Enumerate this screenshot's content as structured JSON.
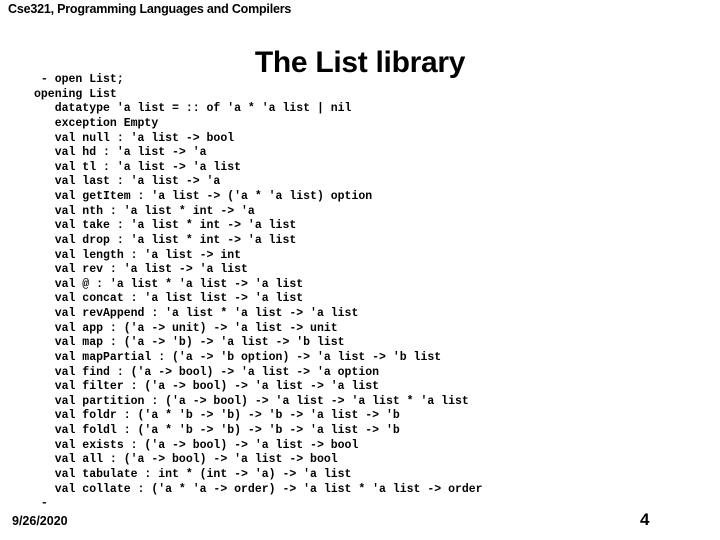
{
  "slide": {
    "course_header": "Cse321, Programming Languages and Compilers",
    "title": "The List library",
    "footer_date": "9/26/2020",
    "page_number": "4",
    "background_color": "#ffffff",
    "text_color": "#000000"
  },
  "code": {
    "lines": [
      " - open List;",
      "opening List",
      "   datatype 'a list = :: of 'a * 'a list | nil",
      "   exception Empty",
      "   val null : 'a list -> bool",
      "   val hd : 'a list -> 'a",
      "   val tl : 'a list -> 'a list",
      "   val last : 'a list -> 'a",
      "   val getItem : 'a list -> ('a * 'a list) option",
      "   val nth : 'a list * int -> 'a",
      "   val take : 'a list * int -> 'a list",
      "   val drop : 'a list * int -> 'a list",
      "   val length : 'a list -> int",
      "   val rev : 'a list -> 'a list",
      "   val @ : 'a list * 'a list -> 'a list",
      "   val concat : 'a list list -> 'a list",
      "   val revAppend : 'a list * 'a list -> 'a list",
      "   val app : ('a -> unit) -> 'a list -> unit",
      "   val map : ('a -> 'b) -> 'a list -> 'b list",
      "   val mapPartial : ('a -> 'b option) -> 'a list -> 'b list",
      "   val find : ('a -> bool) -> 'a list -> 'a option",
      "   val filter : ('a -> bool) -> 'a list -> 'a list",
      "   val partition : ('a -> bool) -> 'a list -> 'a list * 'a list",
      "   val foldr : ('a * 'b -> 'b) -> 'b -> 'a list -> 'b",
      "   val foldl : ('a * 'b -> 'b) -> 'b -> 'a list -> 'b",
      "   val exists : ('a -> bool) -> 'a list -> bool",
      "   val all : ('a -> bool) -> 'a list -> bool",
      "   val tabulate : int * (int -> 'a) -> 'a list",
      "   val collate : ('a * 'a -> order) -> 'a list * 'a list -> order",
      " -"
    ]
  }
}
